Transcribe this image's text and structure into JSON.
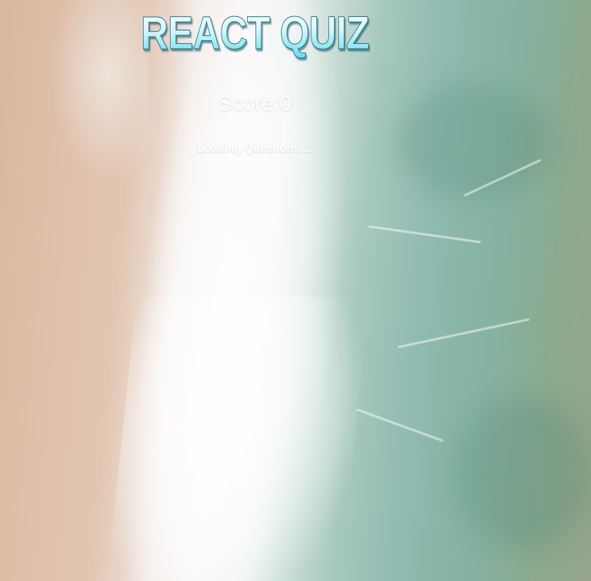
{
  "app": {
    "title": "REACT QUIZ",
    "score_text": "Score:0",
    "status_text": "Loading Questions ..."
  },
  "background": {
    "description_colors": {
      "sand": "#d8b7a0",
      "foam": "#f9f7f6",
      "sea": "#86b3a4"
    }
  }
}
